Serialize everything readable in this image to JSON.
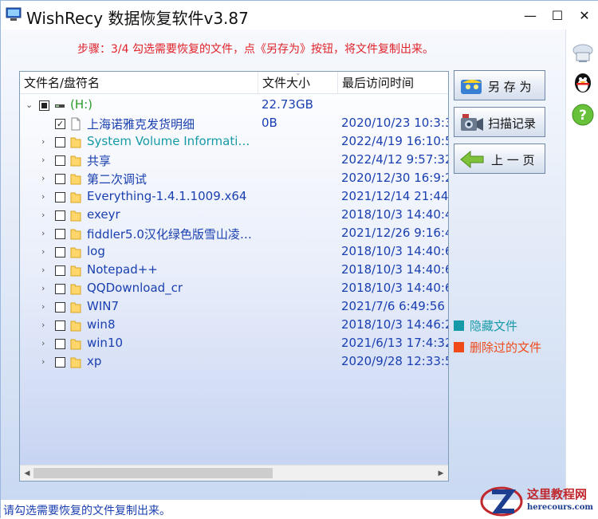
{
  "window": {
    "title": "WishRecy 数据恢复软件v3.87",
    "minimize": "—",
    "maximize": "☐",
    "close": "✕"
  },
  "step_text": "步骤：3/4 勾选需要恢复的文件，点《另存为》按钮，将文件复制出来。",
  "columns": {
    "name": "文件名/盘符名",
    "size": "文件大小",
    "date": "最后访问时间"
  },
  "rows": [
    {
      "name": "(H:)",
      "size": "22.73GB",
      "date": "",
      "level": 0,
      "type": "drive",
      "check": "partial",
      "expander": "⌄",
      "color": "#2a9a2a"
    },
    {
      "name": "上海诺雅克发货明细",
      "size": "0B",
      "date": "2020/10/23 10:3:3",
      "level": 1,
      "type": "file",
      "check": "checked",
      "expander": "",
      "color": "#1a3fb0"
    },
    {
      "name": "System Volume Informati…",
      "size": "",
      "date": "2022/4/19 16:10:5",
      "level": 1,
      "type": "folder",
      "check": "",
      "expander": "›",
      "color": "#169aa8"
    },
    {
      "name": "共享",
      "size": "",
      "date": "2022/4/12 9:57:32",
      "level": 1,
      "type": "folder",
      "check": "",
      "expander": "›",
      "color": "#1a3fb0"
    },
    {
      "name": "第二次调试",
      "size": "",
      "date": "2020/12/30 16:9:2",
      "level": 1,
      "type": "folder",
      "check": "",
      "expander": "›",
      "color": "#1a3fb0"
    },
    {
      "name": "Everything-1.4.1.1009.x64",
      "size": "",
      "date": "2021/12/14 21:44:",
      "level": 1,
      "type": "folder",
      "check": "",
      "expander": "›",
      "color": "#1a3fb0"
    },
    {
      "name": "exeyr",
      "size": "",
      "date": "2018/10/3 14:40:4",
      "level": 1,
      "type": "folder",
      "check": "",
      "expander": "›",
      "color": "#1a3fb0"
    },
    {
      "name": "fiddler5.0汉化绿色版雪山凌…",
      "size": "",
      "date": "2021/12/26 9:16:4",
      "level": 1,
      "type": "folder",
      "check": "",
      "expander": "›",
      "color": "#1a3fb0"
    },
    {
      "name": "log",
      "size": "",
      "date": "2018/10/3 14:40:6",
      "level": 1,
      "type": "folder",
      "check": "",
      "expander": "›",
      "color": "#1a3fb0"
    },
    {
      "name": "Notepad++",
      "size": "",
      "date": "2018/10/3 14:40:6",
      "level": 1,
      "type": "folder",
      "check": "",
      "expander": "›",
      "color": "#1a3fb0"
    },
    {
      "name": "QQDownload_cr",
      "size": "",
      "date": "2018/10/3 14:40:6",
      "level": 1,
      "type": "folder",
      "check": "",
      "expander": "›",
      "color": "#1a3fb0"
    },
    {
      "name": "WIN7",
      "size": "",
      "date": "2021/7/6 6:49:56",
      "level": 1,
      "type": "folder",
      "check": "",
      "expander": "›",
      "color": "#1a3fb0"
    },
    {
      "name": "win8",
      "size": "",
      "date": "2018/10/3 14:46:2",
      "level": 1,
      "type": "folder",
      "check": "",
      "expander": "›",
      "color": "#1a3fb0"
    },
    {
      "name": "win10",
      "size": "",
      "date": "2021/6/13 17:4:32",
      "level": 1,
      "type": "folder",
      "check": "",
      "expander": "›",
      "color": "#1a3fb0"
    },
    {
      "name": "xp",
      "size": "",
      "date": "2020/9/28 12:33:5",
      "level": 1,
      "type": "folder",
      "check": "",
      "expander": "›",
      "color": "#1a3fb0"
    }
  ],
  "buttons": {
    "save_as": "另 存 为",
    "scan_log": "扫描记录",
    "prev_page": "上 一 页"
  },
  "legend": [
    {
      "label": "隐藏文件",
      "color": "#169aa8"
    },
    {
      "label": "删除过的文件",
      "color": "#f04a1a"
    }
  ],
  "status_text": "请勾选需要恢复的文件复制出来。",
  "watermark": {
    "title": "这里教程网",
    "subtitle": "herecours.com"
  }
}
